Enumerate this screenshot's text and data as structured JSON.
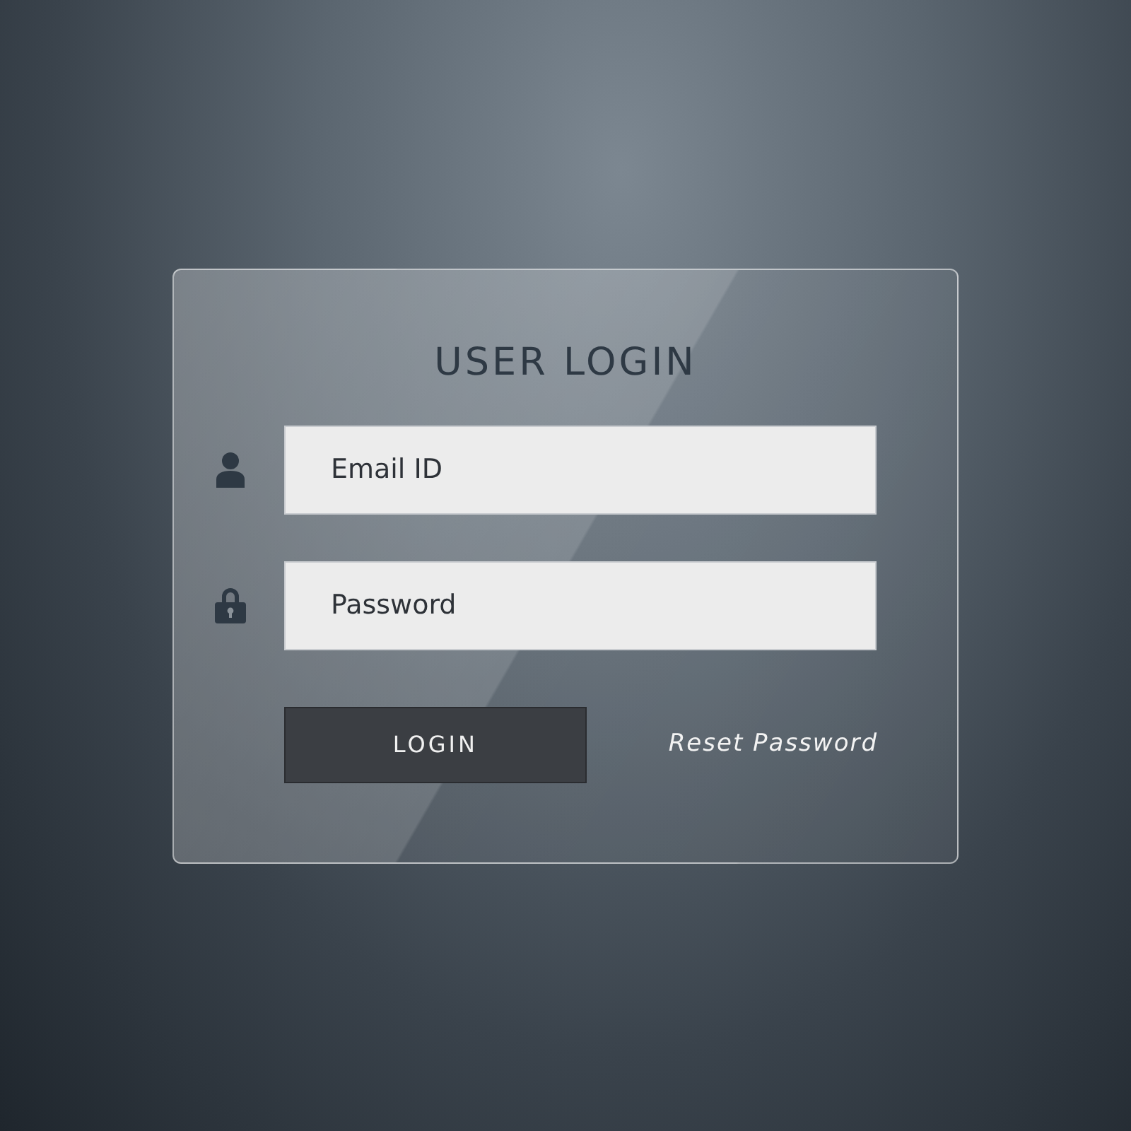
{
  "form": {
    "title": "USER LOGIN",
    "fields": [
      {
        "kind": "email",
        "placeholder": "Email ID"
      },
      {
        "kind": "password",
        "placeholder": "Password"
      }
    ],
    "login_button": "LOGIN",
    "reset_link": "Reset Password"
  }
}
